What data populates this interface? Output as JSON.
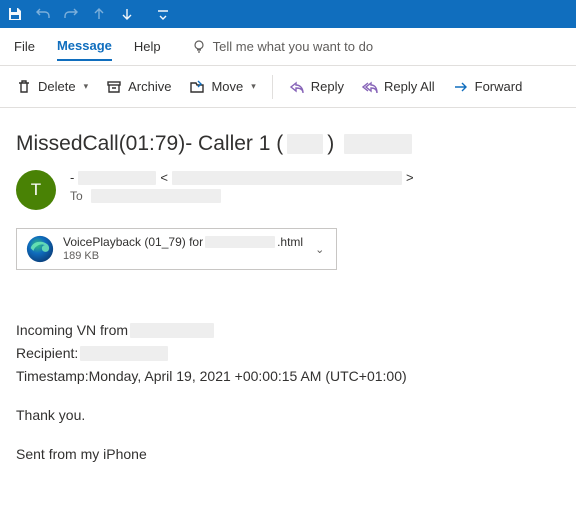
{
  "menubar": {
    "file": "File",
    "message": "Message",
    "help": "Help",
    "tellme": "Tell me what you want to do"
  },
  "toolbar": {
    "delete": "Delete",
    "archive": "Archive",
    "move": "Move",
    "reply": "Reply",
    "replyall": "Reply All",
    "forward": "Forward"
  },
  "subject": {
    "prefix": "MissedCall(01:79)- Caller 1 (",
    "suffix": ")"
  },
  "avatar_initial": "T",
  "sender": {
    "dash": "-",
    "lt": "<",
    "gt": ">",
    "to_label": "To"
  },
  "attachment": {
    "name_prefix": "VoicePlayback (01_79)  for ",
    "name_suffix": ".html",
    "size": "189 KB"
  },
  "email_body": {
    "line1_prefix": "Incoming VN  from",
    "line2_prefix": "Recipient:",
    "line3": "Timestamp:Monday, April 19, 2021 +00:00:15 AM (UTC+01:00)",
    "thanks": "Thank you.",
    "signature": "Sent from my iPhone"
  }
}
